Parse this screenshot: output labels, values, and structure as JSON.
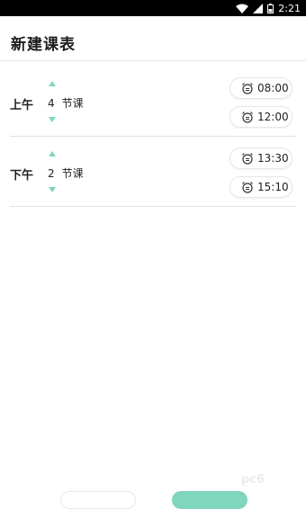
{
  "status_bar": {
    "time": "2:21",
    "icons": [
      "wifi-icon",
      "signal-icon",
      "battery-icon"
    ]
  },
  "header": {
    "title": "新建课表"
  },
  "sections": [
    {
      "label": "上午",
      "count": "4",
      "unit": "节课",
      "times": [
        "08:00",
        "12:00"
      ]
    },
    {
      "label": "下午",
      "count": "2",
      "unit": "节课",
      "times": [
        "13:30",
        "15:10"
      ]
    }
  ],
  "watermark": {
    "text": "pc6"
  },
  "colors": {
    "accent": "#7fd6bd",
    "divider": "#e3e3e3",
    "status_bar": "#000000"
  }
}
